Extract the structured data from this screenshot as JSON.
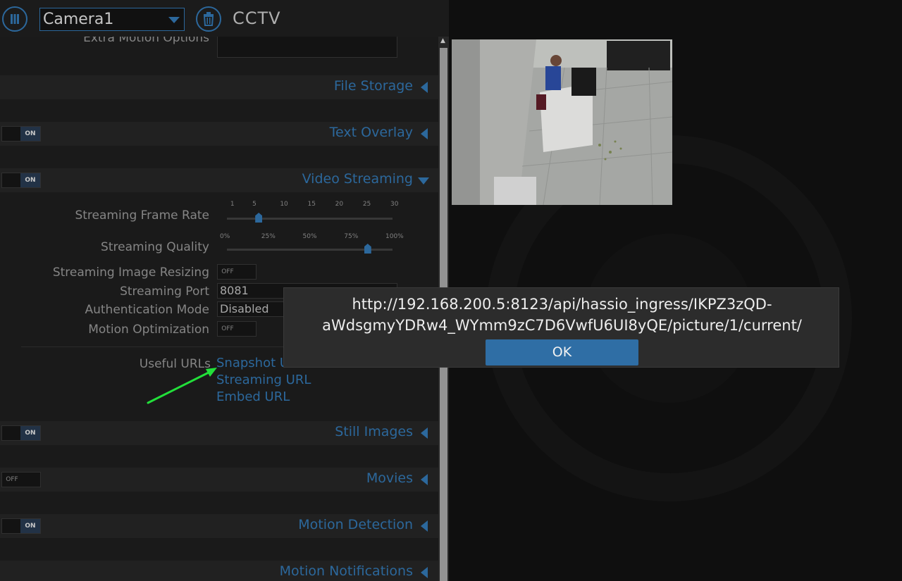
{
  "header": {
    "camera_select": "Camera1",
    "app_title": "CCTV"
  },
  "motion": {
    "extra_label": "Extra Motion Options"
  },
  "sections": {
    "file_storage": "File Storage",
    "text_overlay": "Text Overlay",
    "video_streaming": "Video Streaming",
    "still_images": "Still Images",
    "movies": "Movies",
    "motion_detection": "Motion Detection",
    "motion_notifications": "Motion Notifications"
  },
  "toggles": {
    "on": "ON",
    "off": "OFF",
    "text_overlay": true,
    "video_streaming": true,
    "still_images": true,
    "movies": false,
    "motion_detection": true,
    "streaming_image_resizing": false,
    "motion_optimization": false
  },
  "streaming": {
    "frame_rate_label": "Streaming Frame Rate",
    "frame_rate_ticks": [
      "1",
      "5",
      "10",
      "15",
      "20",
      "25",
      "30"
    ],
    "frame_rate_value": 5,
    "quality_label": "Streaming Quality",
    "quality_ticks": [
      "0%",
      "25%",
      "50%",
      "75%",
      "100%"
    ],
    "quality_value": 85,
    "resizing_label": "Streaming Image Resizing",
    "port_label": "Streaming Port",
    "port_value": "8081",
    "auth_label": "Authentication Mode",
    "auth_value": "Disabled",
    "motion_opt_label": "Motion Optimization",
    "useful_urls_label": "Useful URLs",
    "snapshot_url": "Snapshot URL",
    "streaming_url": "Streaming URL",
    "embed_url": "Embed URL"
  },
  "dialog": {
    "line1": "http://192.168.200.5:8123/api/hassio_ingress/IKPZ3zQD-",
    "line2": "aWdsgmyYDRw4_WYmm9zC7D6VwfU6UI8yQE/picture/1/current/",
    "ok_label": "OK"
  },
  "colors": {
    "accent": "#2f6ea5",
    "annotation_arrow": "#22e03a"
  }
}
